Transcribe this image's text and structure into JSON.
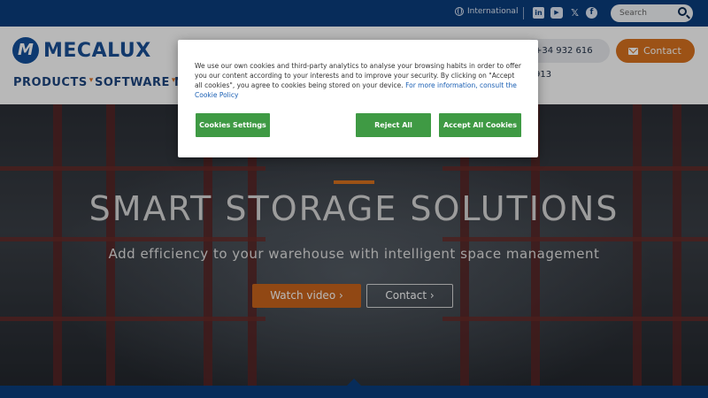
{
  "topbar": {
    "international_label": "International",
    "social": [
      "linkedin-icon",
      "youtube-icon",
      "x-icon",
      "facebook-icon"
    ],
    "search_placeholder": "Search"
  },
  "header": {
    "logo_mark": "M",
    "logo_text": "MECALUX",
    "nav": [
      {
        "label": "PRODUCTS"
      },
      {
        "label": "SOFTWARE"
      },
      {
        "label": "M"
      }
    ],
    "phone": "+34 932 616 913",
    "contact_label": "Contact"
  },
  "hero": {
    "title": "SMART STORAGE SOLUTIONS",
    "subtitle": "Add efficiency to your warehouse with intelligent space management",
    "watch_label": "Watch video ›",
    "contact_label": "Contact ›"
  },
  "cookie_banner": {
    "text": "We use our own cookies and third-party analytics to analyse your browsing habits in order to offer you our content according to your interests and to improve your security. By clicking on \"Accept all cookies\", you agree to cookies being stored on your device.",
    "policy_link": "For more information, consult the Cookie Policy",
    "settings_label": "Cookies Settings",
    "reject_label": "Reject All",
    "accept_label": "Accept All Cookies"
  },
  "colors": {
    "brand_blue": "#0b3d7d",
    "accent_orange": "#d9721f",
    "cookie_green": "#3f9a44"
  }
}
